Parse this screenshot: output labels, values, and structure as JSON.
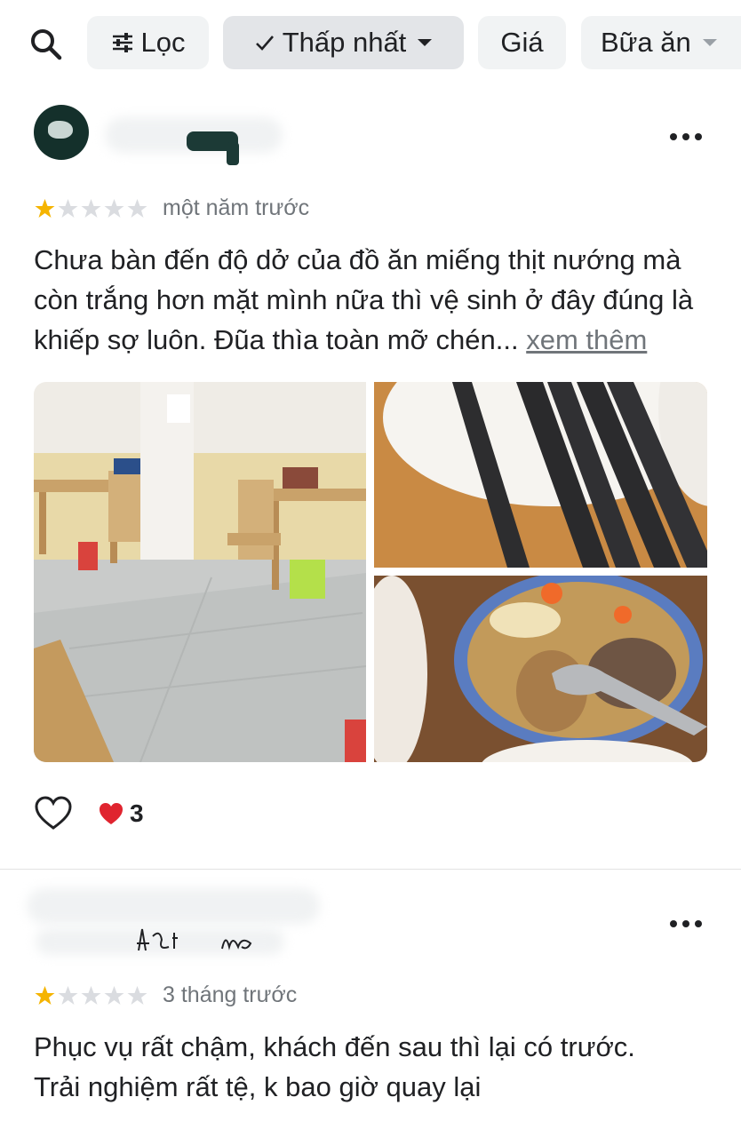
{
  "filters": {
    "search_icon": "search-icon",
    "chips": [
      {
        "label": "Lọc",
        "icon": "tune-icon"
      },
      {
        "label": "Thấp nhất",
        "icon": "check-icon",
        "selected": true
      },
      {
        "label": "Giá"
      },
      {
        "label": "Bữa ăn",
        "icon": "chevron-down-icon"
      }
    ]
  },
  "reviews": [
    {
      "rating": 1,
      "max_rating": 5,
      "time": "một năm trước",
      "text": "Chưa bàn đến độ dở của đồ ăn miếng thịt nướng mà còn trắng hơn mặt mình nữa thì vệ sinh ở đây đúng là khiếp sợ luôn. Đũa thìa toàn mỡ chén...",
      "more_label": "xem thêm",
      "photos": [
        "restaurant-interior-photo",
        "chopsticks-photo",
        "soup-bowl-photo"
      ],
      "reaction_count": "3"
    },
    {
      "rating": 1,
      "max_rating": 5,
      "time": "3 tháng trước",
      "text_lines": [
        "Phục vụ rất chậm, khách đến sau thì lại có trước.",
        "Trải nghiệm rất tệ, k bao giờ quay lại"
      ]
    }
  ],
  "colors": {
    "star_filled": "#f5b400",
    "star_empty": "#dadce0",
    "chip_bg": "#f1f3f4",
    "secondary_text": "#70757a",
    "heart": "#e0242f"
  }
}
